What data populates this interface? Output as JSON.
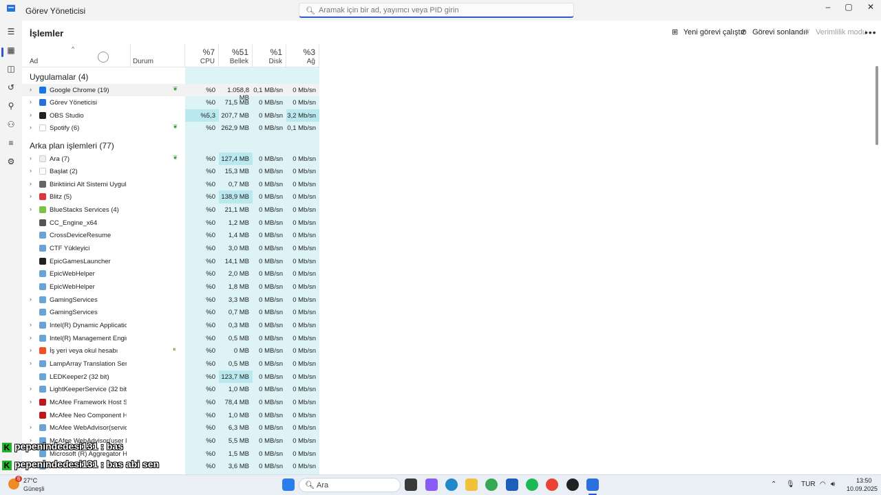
{
  "window": {
    "title": "Görev Yöneticisi",
    "search_placeholder": "Aramak için bir ad, yayımcı veya PID girin",
    "minimize_glyph": "–",
    "maximize_glyph": "▢",
    "close_glyph": "✕"
  },
  "toolbar": {
    "page_title": "İşlemler",
    "new_task": "Yeni görevi çalıştır",
    "end_task": "Görevi sonlandır",
    "efficiency": "Verimlilik modu",
    "more": "•••"
  },
  "columns": {
    "name": "Ad",
    "status": "Durum",
    "cpu_pct": "%7",
    "cpu": "CPU",
    "mem_pct": "%51",
    "mem": "Bellek",
    "disk_pct": "%1",
    "disk": "Disk",
    "net_pct": "%3",
    "net": "Ağ"
  },
  "groups": {
    "apps": "Uygulamalar (4)",
    "background": "Arka plan işlemleri (77)"
  },
  "apps": [
    {
      "name": "Google Chrome (19)",
      "expand": true,
      "eco": true,
      "cpu": "%0",
      "mem": "1.058,8 MB",
      "disk": "0,1 MB/sn",
      "net": "0 Mb/sn",
      "icon": "chrome-icon",
      "color": "#1a73e8",
      "selected": true
    },
    {
      "name": "Görev Yöneticisi",
      "expand": true,
      "eco": false,
      "cpu": "%0",
      "mem": "71,5 MB",
      "disk": "0 MB/sn",
      "net": "0 Mb/sn",
      "icon": "task-manager-icon",
      "color": "#2a6fdb"
    },
    {
      "name": "OBS Studio",
      "expand": true,
      "eco": false,
      "cpu": "%5,3",
      "mem": "207,7 MB",
      "disk": "0 MB/sn",
      "net": "3,2 Mb/sn",
      "icon": "obs-icon",
      "color": "#222222",
      "cpu_hot": true,
      "net_hot": true
    },
    {
      "name": "Spotify (6)",
      "expand": true,
      "eco": true,
      "cpu": "%0",
      "mem": "262,9 MB",
      "disk": "0 MB/sn",
      "net": "0,1 Mb/sn",
      "icon": "spotify-icon",
      "color": "#ffffff"
    }
  ],
  "background": [
    {
      "name": "Ara (7)",
      "expand": true,
      "eco": true,
      "cpu": "%0",
      "mem": "127,4 MB",
      "disk": "0 MB/sn",
      "net": "0 Mb/sn",
      "icon": "search-app-icon",
      "color": "#eeeeee",
      "mem_hot": true
    },
    {
      "name": "Başlat (2)",
      "expand": true,
      "eco": false,
      "cpu": "%0",
      "mem": "15,3 MB",
      "disk": "0 MB/sn",
      "net": "0 Mb/sn",
      "icon": "start-icon",
      "color": "#ffffff"
    },
    {
      "name": "Biriktiirici Alt Sistemi Uygulam...",
      "expand": true,
      "eco": false,
      "cpu": "%0",
      "mem": "0,7 MB",
      "disk": "0 MB/sn",
      "net": "0 Mb/sn",
      "icon": "printer-icon",
      "color": "#666666"
    },
    {
      "name": "Blitz (5)",
      "expand": true,
      "eco": false,
      "cpu": "%0",
      "mem": "138,9 MB",
      "disk": "0 MB/sn",
      "net": "0 Mb/sn",
      "icon": "blitz-icon",
      "color": "#e0343c",
      "mem_hot": true
    },
    {
      "name": "BlueStacks Services (4)",
      "expand": true,
      "eco": false,
      "cpu": "%0",
      "mem": "21,1 MB",
      "disk": "0 MB/sn",
      "net": "0 Mb/sn",
      "icon": "bluestacks-icon",
      "color": "#7cc242"
    },
    {
      "name": "CC_Engine_x64",
      "expand": false,
      "eco": false,
      "cpu": "%0",
      "mem": "1,2 MB",
      "disk": "0 MB/sn",
      "net": "0 Mb/sn",
      "icon": "engine-icon",
      "color": "#555555"
    },
    {
      "name": "CrossDeviceResume",
      "expand": false,
      "eco": false,
      "cpu": "%0",
      "mem": "1,4 MB",
      "disk": "0 MB/sn",
      "net": "0 Mb/sn",
      "icon": "window-icon",
      "color": "#6aa3d8"
    },
    {
      "name": "CTF Yükleyici",
      "expand": false,
      "eco": false,
      "cpu": "%0",
      "mem": "3,0 MB",
      "disk": "0 MB/sn",
      "net": "0 Mb/sn",
      "icon": "window-icon",
      "color": "#6aa3d8"
    },
    {
      "name": "EpicGamesLauncher",
      "expand": false,
      "eco": false,
      "cpu": "%0",
      "mem": "14,1 MB",
      "disk": "0 MB/sn",
      "net": "0 Mb/sn",
      "icon": "epic-icon",
      "color": "#222222"
    },
    {
      "name": "EpicWebHelper",
      "expand": false,
      "eco": false,
      "cpu": "%0",
      "mem": "2,0 MB",
      "disk": "0 MB/sn",
      "net": "0 Mb/sn",
      "icon": "window-icon",
      "color": "#6aa3d8"
    },
    {
      "name": "EpicWebHelper",
      "expand": false,
      "eco": false,
      "cpu": "%0",
      "mem": "1,8 MB",
      "disk": "0 MB/sn",
      "net": "0 Mb/sn",
      "icon": "window-icon",
      "color": "#6aa3d8"
    },
    {
      "name": "GamingServices",
      "expand": true,
      "eco": false,
      "cpu": "%0",
      "mem": "3,3 MB",
      "disk": "0 MB/sn",
      "net": "0 Mb/sn",
      "icon": "window-icon",
      "color": "#6aa3d8"
    },
    {
      "name": "GamingServices",
      "expand": false,
      "eco": false,
      "cpu": "%0",
      "mem": "0,7 MB",
      "disk": "0 MB/sn",
      "net": "0 Mb/sn",
      "icon": "window-icon",
      "color": "#6aa3d8"
    },
    {
      "name": "Intel(R) Dynamic Application ...",
      "expand": true,
      "eco": false,
      "cpu": "%0",
      "mem": "0,3 MB",
      "disk": "0 MB/sn",
      "net": "0 Mb/sn",
      "icon": "window-icon",
      "color": "#6aa3d8"
    },
    {
      "name": "Intel(R) Management Engine ...",
      "expand": true,
      "eco": false,
      "cpu": "%0",
      "mem": "0,5 MB",
      "disk": "0 MB/sn",
      "net": "0 Mb/sn",
      "icon": "window-icon",
      "color": "#6aa3d8"
    },
    {
      "name": "İş yeri veya okul hesabı",
      "expand": true,
      "eco": false,
      "paused": true,
      "cpu": "%0",
      "mem": "0 MB",
      "disk": "0 MB/sn",
      "net": "0 Mb/sn",
      "icon": "microsoft-icon",
      "color": "#f25022"
    },
    {
      "name": "LampArray Translation Service",
      "expand": true,
      "eco": false,
      "cpu": "%0",
      "mem": "0,5 MB",
      "disk": "0 MB/sn",
      "net": "0 Mb/sn",
      "icon": "window-icon",
      "color": "#6aa3d8"
    },
    {
      "name": "LEDKeeper2 (32 bit)",
      "expand": false,
      "eco": false,
      "cpu": "%0",
      "mem": "123,7 MB",
      "disk": "0 MB/sn",
      "net": "0 Mb/sn",
      "icon": "window-icon",
      "color": "#6aa3d8",
      "mem_hot": true
    },
    {
      "name": "LightKeeperService (32 bit)",
      "expand": true,
      "eco": false,
      "cpu": "%0",
      "mem": "1,0 MB",
      "disk": "0 MB/sn",
      "net": "0 Mb/sn",
      "icon": "window-icon",
      "color": "#6aa3d8"
    },
    {
      "name": "McAfee Framework Host Servi...",
      "expand": true,
      "eco": false,
      "cpu": "%0",
      "mem": "78,4 MB",
      "disk": "0 MB/sn",
      "net": "0 Mb/sn",
      "icon": "mcafee-icon",
      "color": "#c01818"
    },
    {
      "name": "McAfee Neo Component Host",
      "expand": false,
      "eco": false,
      "cpu": "%0",
      "mem": "1,0 MB",
      "disk": "0 MB/sn",
      "net": "0 Mb/sn",
      "icon": "mcafee-icon",
      "color": "#c01818"
    },
    {
      "name": "McAfee WebAdvisor(service)",
      "expand": true,
      "eco": false,
      "cpu": "%0",
      "mem": "6,3 MB",
      "disk": "0 MB/sn",
      "net": "0 Mb/sn",
      "icon": "window-icon",
      "color": "#6aa3d8"
    },
    {
      "name": "McAfee WebAdvisor(user leve...",
      "expand": true,
      "eco": false,
      "cpu": "%0",
      "mem": "5,5 MB",
      "disk": "0 MB/sn",
      "net": "0 Mb/sn",
      "icon": "window-icon",
      "color": "#6aa3d8"
    },
    {
      "name": "Microsoft (R) Aggregator Host",
      "expand": false,
      "eco": false,
      "cpu": "%0",
      "mem": "1,5 MB",
      "disk": "0 MB/sn",
      "net": "0 Mb/sn",
      "icon": "window-icon",
      "color": "#6aa3d8"
    },
    {
      "name": "",
      "expand": true,
      "eco": false,
      "cpu": "%0",
      "mem": "3,6 MB",
      "disk": "0 MB/sn",
      "net": "0 Mb/sn",
      "icon": "window-icon",
      "color": "#6aa3d8"
    }
  ],
  "chat": [
    {
      "user": "pepenindedesi131",
      "sep": " : ",
      "msg": "bas"
    },
    {
      "user": "pepenindedesi131",
      "sep": " : ",
      "msg": "bas abi sen"
    }
  ],
  "taskbar": {
    "badge": "6",
    "temp": "27°C",
    "condition": "Güneşli",
    "search": "Ara",
    "lang": "TUR",
    "time": "13:50",
    "date": "10.09.2025"
  }
}
